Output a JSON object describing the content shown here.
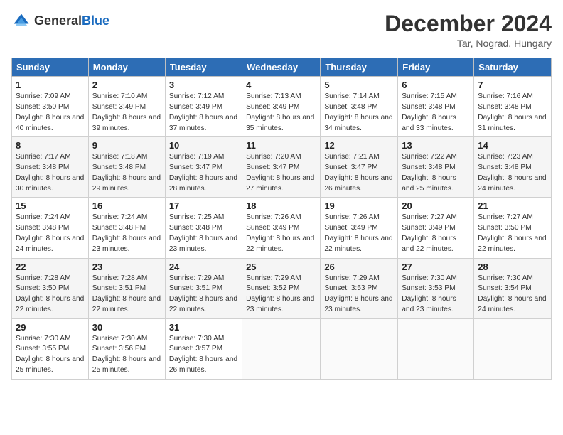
{
  "header": {
    "logo_general": "General",
    "logo_blue": "Blue",
    "month_year": "December 2024",
    "location": "Tar, Nograd, Hungary"
  },
  "columns": [
    "Sunday",
    "Monday",
    "Tuesday",
    "Wednesday",
    "Thursday",
    "Friday",
    "Saturday"
  ],
  "weeks": [
    [
      {
        "day": "1",
        "sunrise": "Sunrise: 7:09 AM",
        "sunset": "Sunset: 3:50 PM",
        "daylight": "Daylight: 8 hours and 40 minutes."
      },
      {
        "day": "2",
        "sunrise": "Sunrise: 7:10 AM",
        "sunset": "Sunset: 3:49 PM",
        "daylight": "Daylight: 8 hours and 39 minutes."
      },
      {
        "day": "3",
        "sunrise": "Sunrise: 7:12 AM",
        "sunset": "Sunset: 3:49 PM",
        "daylight": "Daylight: 8 hours and 37 minutes."
      },
      {
        "day": "4",
        "sunrise": "Sunrise: 7:13 AM",
        "sunset": "Sunset: 3:49 PM",
        "daylight": "Daylight: 8 hours and 35 minutes."
      },
      {
        "day": "5",
        "sunrise": "Sunrise: 7:14 AM",
        "sunset": "Sunset: 3:48 PM",
        "daylight": "Daylight: 8 hours and 34 minutes."
      },
      {
        "day": "6",
        "sunrise": "Sunrise: 7:15 AM",
        "sunset": "Sunset: 3:48 PM",
        "daylight": "Daylight: 8 hours and 33 minutes."
      },
      {
        "day": "7",
        "sunrise": "Sunrise: 7:16 AM",
        "sunset": "Sunset: 3:48 PM",
        "daylight": "Daylight: 8 hours and 31 minutes."
      }
    ],
    [
      {
        "day": "8",
        "sunrise": "Sunrise: 7:17 AM",
        "sunset": "Sunset: 3:48 PM",
        "daylight": "Daylight: 8 hours and 30 minutes."
      },
      {
        "day": "9",
        "sunrise": "Sunrise: 7:18 AM",
        "sunset": "Sunset: 3:48 PM",
        "daylight": "Daylight: 8 hours and 29 minutes."
      },
      {
        "day": "10",
        "sunrise": "Sunrise: 7:19 AM",
        "sunset": "Sunset: 3:47 PM",
        "daylight": "Daylight: 8 hours and 28 minutes."
      },
      {
        "day": "11",
        "sunrise": "Sunrise: 7:20 AM",
        "sunset": "Sunset: 3:47 PM",
        "daylight": "Daylight: 8 hours and 27 minutes."
      },
      {
        "day": "12",
        "sunrise": "Sunrise: 7:21 AM",
        "sunset": "Sunset: 3:47 PM",
        "daylight": "Daylight: 8 hours and 26 minutes."
      },
      {
        "day": "13",
        "sunrise": "Sunrise: 7:22 AM",
        "sunset": "Sunset: 3:48 PM",
        "daylight": "Daylight: 8 hours and 25 minutes."
      },
      {
        "day": "14",
        "sunrise": "Sunrise: 7:23 AM",
        "sunset": "Sunset: 3:48 PM",
        "daylight": "Daylight: 8 hours and 24 minutes."
      }
    ],
    [
      {
        "day": "15",
        "sunrise": "Sunrise: 7:24 AM",
        "sunset": "Sunset: 3:48 PM",
        "daylight": "Daylight: 8 hours and 24 minutes."
      },
      {
        "day": "16",
        "sunrise": "Sunrise: 7:24 AM",
        "sunset": "Sunset: 3:48 PM",
        "daylight": "Daylight: 8 hours and 23 minutes."
      },
      {
        "day": "17",
        "sunrise": "Sunrise: 7:25 AM",
        "sunset": "Sunset: 3:48 PM",
        "daylight": "Daylight: 8 hours and 23 minutes."
      },
      {
        "day": "18",
        "sunrise": "Sunrise: 7:26 AM",
        "sunset": "Sunset: 3:49 PM",
        "daylight": "Daylight: 8 hours and 22 minutes."
      },
      {
        "day": "19",
        "sunrise": "Sunrise: 7:26 AM",
        "sunset": "Sunset: 3:49 PM",
        "daylight": "Daylight: 8 hours and 22 minutes."
      },
      {
        "day": "20",
        "sunrise": "Sunrise: 7:27 AM",
        "sunset": "Sunset: 3:49 PM",
        "daylight": "Daylight: 8 hours and 22 minutes."
      },
      {
        "day": "21",
        "sunrise": "Sunrise: 7:27 AM",
        "sunset": "Sunset: 3:50 PM",
        "daylight": "Daylight: 8 hours and 22 minutes."
      }
    ],
    [
      {
        "day": "22",
        "sunrise": "Sunrise: 7:28 AM",
        "sunset": "Sunset: 3:50 PM",
        "daylight": "Daylight: 8 hours and 22 minutes."
      },
      {
        "day": "23",
        "sunrise": "Sunrise: 7:28 AM",
        "sunset": "Sunset: 3:51 PM",
        "daylight": "Daylight: 8 hours and 22 minutes."
      },
      {
        "day": "24",
        "sunrise": "Sunrise: 7:29 AM",
        "sunset": "Sunset: 3:51 PM",
        "daylight": "Daylight: 8 hours and 22 minutes."
      },
      {
        "day": "25",
        "sunrise": "Sunrise: 7:29 AM",
        "sunset": "Sunset: 3:52 PM",
        "daylight": "Daylight: 8 hours and 23 minutes."
      },
      {
        "day": "26",
        "sunrise": "Sunrise: 7:29 AM",
        "sunset": "Sunset: 3:53 PM",
        "daylight": "Daylight: 8 hours and 23 minutes."
      },
      {
        "day": "27",
        "sunrise": "Sunrise: 7:30 AM",
        "sunset": "Sunset: 3:53 PM",
        "daylight": "Daylight: 8 hours and 23 minutes."
      },
      {
        "day": "28",
        "sunrise": "Sunrise: 7:30 AM",
        "sunset": "Sunset: 3:54 PM",
        "daylight": "Daylight: 8 hours and 24 minutes."
      }
    ],
    [
      {
        "day": "29",
        "sunrise": "Sunrise: 7:30 AM",
        "sunset": "Sunset: 3:55 PM",
        "daylight": "Daylight: 8 hours and 25 minutes."
      },
      {
        "day": "30",
        "sunrise": "Sunrise: 7:30 AM",
        "sunset": "Sunset: 3:56 PM",
        "daylight": "Daylight: 8 hours and 25 minutes."
      },
      {
        "day": "31",
        "sunrise": "Sunrise: 7:30 AM",
        "sunset": "Sunset: 3:57 PM",
        "daylight": "Daylight: 8 hours and 26 minutes."
      },
      null,
      null,
      null,
      null
    ]
  ]
}
